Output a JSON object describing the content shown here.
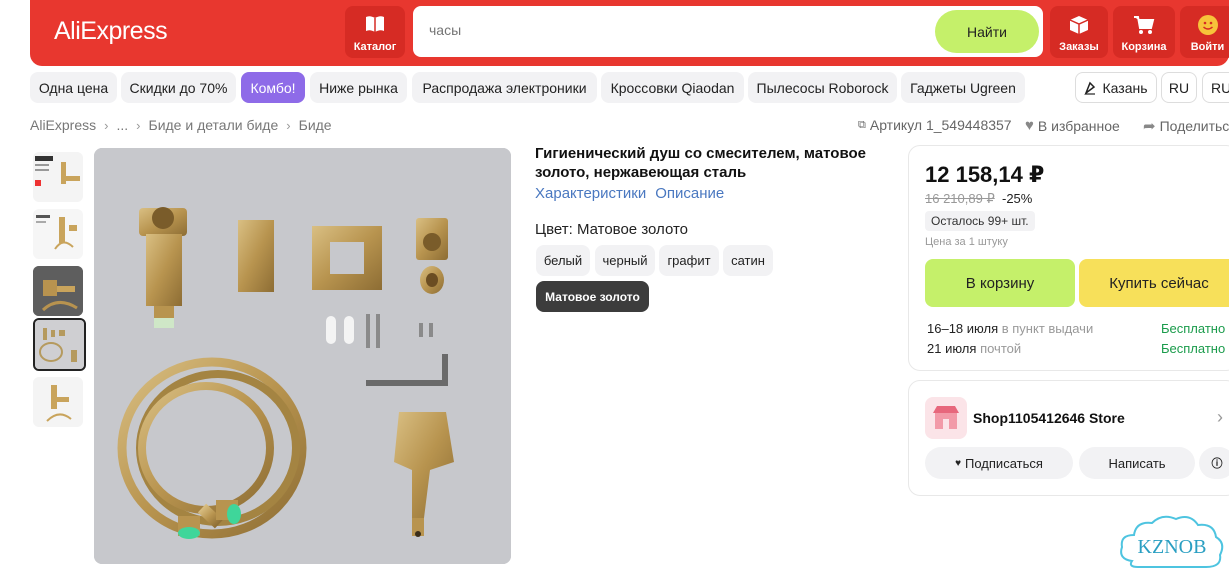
{
  "header": {
    "logo": "AliExpress",
    "catalog_label": "Каталог",
    "search_placeholder": "часы",
    "search_button": "Найти",
    "orders_label": "Заказы",
    "cart_label": "Корзина",
    "login_label": "Войти"
  },
  "chips": [
    "Одна цена",
    "Скидки до 70%",
    "Комбо!",
    "Ниже рынка",
    "Распродажа электроники",
    "Кроссовки Qiaodan",
    "Пылесосы Roborock",
    "Гаджеты Ugreen"
  ],
  "location": "Казань",
  "lang": "RU",
  "currency": "RU",
  "breadcrumb": [
    "AliExpress",
    "...",
    "Биде и детали биде",
    "Биде"
  ],
  "article": "Артикул 1_549448357",
  "favorite": "В избранное",
  "share": "Поделиться",
  "product": {
    "title": "Гигиенический душ со смесителем, матовое золото, нержавеющая сталь",
    "link_specs": "Характеристики",
    "link_desc": "Описание",
    "color_label": "Цвет: Матовое золото",
    "options": [
      "белый",
      "черный",
      "графит",
      "сатин"
    ],
    "selected_option": "Матовое золото"
  },
  "buy": {
    "price": "12 158,14 ₽",
    "old_price": "16 210,89 ₽",
    "discount": "-25%",
    "stock": "Осталось 99+ шт.",
    "per_unit": "Цена за 1 штуку",
    "cart_button": "В корзину",
    "buy_button": "Купить сейчас",
    "delivery1_date": "16–18 июля",
    "delivery1_method": "в пункт выдачи",
    "delivery1_price": "Бесплатно",
    "delivery2_date": "21 июля",
    "delivery2_method": "почтой",
    "delivery2_price": "Бесплатно"
  },
  "store": {
    "name": "Shop1105412646 Store",
    "subscribe": "Подписаться",
    "message": "Написать"
  },
  "watermark": "KZNOB",
  "colors": {
    "brand": "#e8372f",
    "accent_green": "#c5f06a",
    "accent_yellow": "#f7e05a",
    "chip_active": "#8e6be8",
    "link": "#4a78c0"
  }
}
